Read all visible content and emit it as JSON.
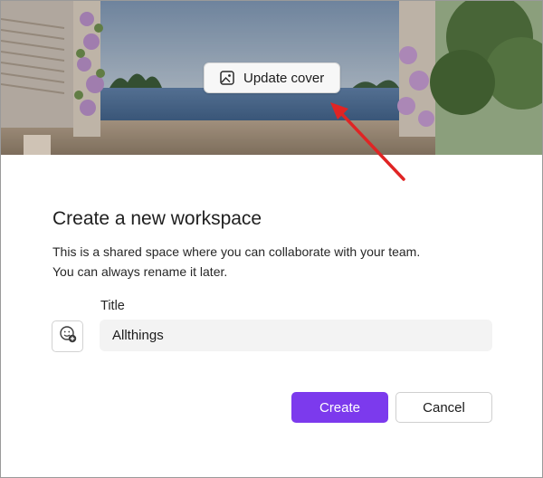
{
  "cover": {
    "update_label": "Update cover",
    "image_icon": "image-icon"
  },
  "dialog": {
    "heading": "Create a new workspace",
    "description_line1": "This is a shared space where you can collaborate with your team.",
    "description_line2": "You can always rename it later."
  },
  "form": {
    "title_label": "Title",
    "title_value": "Allthings",
    "emoji_icon": "emoji-add-icon"
  },
  "actions": {
    "create_label": "Create",
    "cancel_label": "Cancel"
  },
  "colors": {
    "accent": "#7c3aed",
    "annotation_arrow": "#e02424"
  }
}
